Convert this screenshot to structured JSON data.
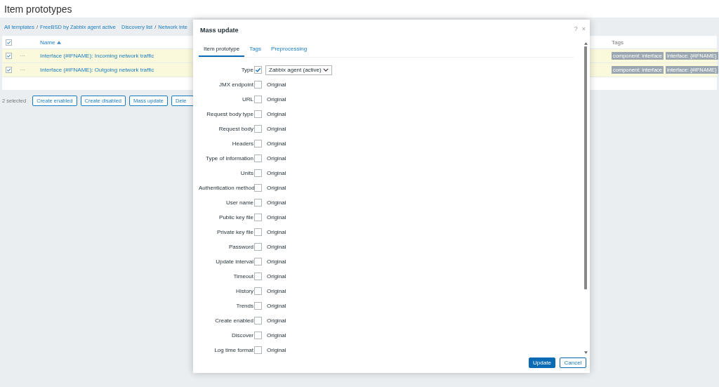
{
  "page_title": "Item prototypes",
  "breadcrumbs": [
    {
      "kind": "link",
      "label": "All templates"
    },
    {
      "kind": "separator",
      "label": "/"
    },
    {
      "kind": "link",
      "label": "FreeBSD by Zabbix agent active"
    },
    {
      "kind": "gap"
    },
    {
      "kind": "link",
      "label": "Discovery list"
    },
    {
      "kind": "separator",
      "label": "/"
    },
    {
      "kind": "link",
      "label": "Network inte"
    }
  ],
  "table": {
    "header_checked": true,
    "columns": [
      {
        "label": "Name",
        "sorted_ascending": true
      },
      {
        "label": "Tags"
      }
    ],
    "rows": [
      {
        "checked": true,
        "menu": "···",
        "name": "Interface (#IFNAME): Incoming network traffic",
        "tags": [
          "component: interface",
          "interface: {#IFNAME}"
        ]
      },
      {
        "checked": true,
        "menu": "···",
        "name": "Interface (#IFNAME): Outgoing network traffic",
        "tags": [
          "component: interface",
          "interface: {#IFNAME}"
        ]
      }
    ]
  },
  "selection_count": "2 selected",
  "actions": [
    "Create enabled",
    "Create disabled",
    "Mass update",
    "Dele"
  ],
  "dialog": {
    "title": "Mass update",
    "help": "?",
    "close": "×",
    "tabs": [
      {
        "label": "Item prototype",
        "selected": true
      },
      {
        "label": "Tags",
        "selected": false
      },
      {
        "label": "Preprocessing",
        "selected": false
      }
    ],
    "fields": [
      {
        "label": "Type",
        "checked": true,
        "kind": "select",
        "value": "Zabbix agent (active)"
      },
      {
        "label": "JMX endpoint",
        "checked": false,
        "kind": "text",
        "value": "Original"
      },
      {
        "label": "URL",
        "checked": false,
        "kind": "text",
        "value": "Original"
      },
      {
        "label": "Request body type",
        "checked": false,
        "kind": "text",
        "value": "Original"
      },
      {
        "label": "Request body",
        "checked": false,
        "kind": "text",
        "value": "Original"
      },
      {
        "label": "Headers",
        "checked": false,
        "kind": "text",
        "value": "Original"
      },
      {
        "label": "Type of information",
        "checked": false,
        "kind": "text",
        "value": "Original"
      },
      {
        "label": "Units",
        "checked": false,
        "kind": "text",
        "value": "Original"
      },
      {
        "label": "Authentication method",
        "checked": false,
        "kind": "text",
        "value": "Original"
      },
      {
        "label": "User name",
        "checked": false,
        "kind": "text",
        "value": "Original"
      },
      {
        "label": "Public key file",
        "checked": false,
        "kind": "text",
        "value": "Original"
      },
      {
        "label": "Private key file",
        "checked": false,
        "kind": "text",
        "value": "Original"
      },
      {
        "label": "Password",
        "checked": false,
        "kind": "text",
        "value": "Original"
      },
      {
        "label": "Update interval",
        "checked": false,
        "kind": "text",
        "value": "Original"
      },
      {
        "label": "Timeout",
        "checked": false,
        "kind": "text",
        "value": "Original"
      },
      {
        "label": "History",
        "checked": false,
        "kind": "text",
        "value": "Original"
      },
      {
        "label": "Trends",
        "checked": false,
        "kind": "text",
        "value": "Original"
      },
      {
        "label": "Create enabled",
        "checked": false,
        "kind": "text",
        "value": "Original"
      },
      {
        "label": "Discover",
        "checked": false,
        "kind": "text",
        "value": "Original"
      },
      {
        "label": "Log time format",
        "checked": false,
        "kind": "text",
        "value": "Original"
      }
    ],
    "buttons": [
      {
        "label": "Update",
        "primary": true
      },
      {
        "label": "Cancel",
        "primary": false
      }
    ]
  }
}
